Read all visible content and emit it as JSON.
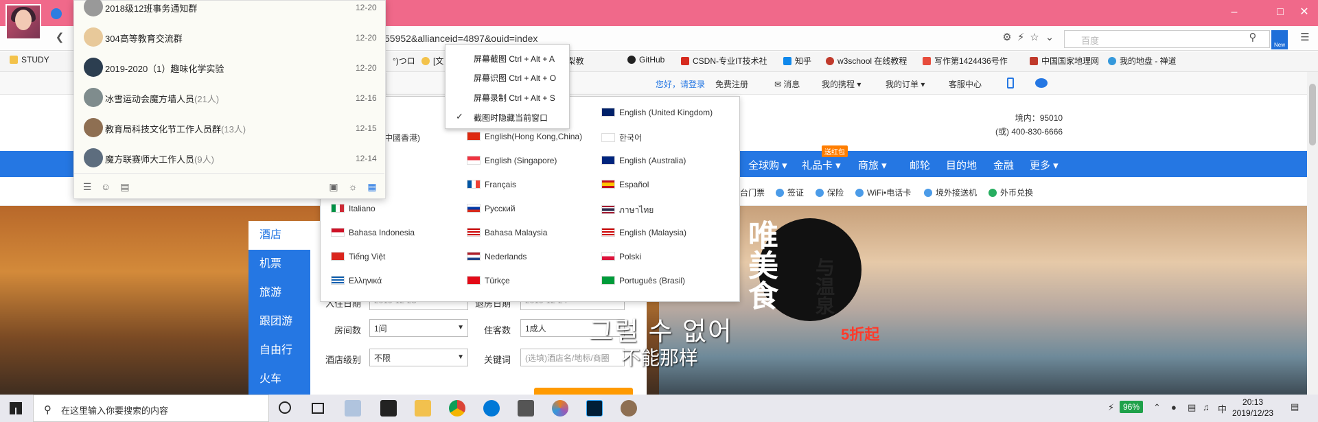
{
  "browser": {
    "url": "55952&allianceid=4897&ouid=index",
    "search_placeholder": "百度",
    "new_badge": "New",
    "colors": {
      "titlebar": "#f0698a",
      "nav_blue": "#2577e3",
      "accent_orange": "#ff9a00"
    }
  },
  "bookmarks": [
    {
      "label": "STUDY"
    },
    {
      "label": "°)つロ"
    },
    {
      "label": "[文"
    },
    {
      "label": "主题 - 雪梨教"
    },
    {
      "label": "GitHub"
    },
    {
      "label": "CSDN-专业IT技术社"
    },
    {
      "label": "知乎"
    },
    {
      "label": "w3school 在线教程"
    },
    {
      "label": "写作第1424436号作"
    },
    {
      "label": "中国国家地理网"
    },
    {
      "label": "我的地盘 - 禅道"
    }
  ],
  "site_top": {
    "greeting": "您好，请登录",
    "register": "免费注册",
    "messages": "消息",
    "my_trip": "我的携程",
    "my_orders": "我的订单",
    "service": "客服中心"
  },
  "hotline": {
    "line1": "境内：95010",
    "line2": "(或) 400-830-6666"
  },
  "main_nav": [
    {
      "label": "全球购"
    },
    {
      "label": "礼品卡"
    },
    {
      "label": "商旅"
    },
    {
      "label": "邮轮"
    },
    {
      "label": "目的地"
    },
    {
      "label": "金融"
    },
    {
      "label": "更多"
    }
  ],
  "gift_badge": "送红包",
  "sub_nav": [
    {
      "label": "台门票"
    },
    {
      "label": "签证"
    },
    {
      "label": "保险"
    },
    {
      "label": "WiFi•电话卡"
    },
    {
      "label": "境外接送机"
    },
    {
      "label": "外币兑换"
    }
  ],
  "booking": {
    "tabs": [
      {
        "label": "酒店"
      },
      {
        "label": "机票"
      },
      {
        "label": "旅游"
      },
      {
        "label": "跟团游"
      },
      {
        "label": "自由行"
      },
      {
        "label": "火车"
      }
    ],
    "checkin_label": "入住日期",
    "checkin_value": "2019-12-23",
    "checkout_label": "退房日期",
    "checkout_value": "2019-12-24",
    "rooms_label": "房间数",
    "rooms_value": "1间",
    "guests_label": "住客数",
    "guests_value": "1成人",
    "level_label": "酒店级别",
    "level_value": "不限",
    "keyword_label": "关键词",
    "keyword_placeholder": "(选填)酒店名/地标/商圈"
  },
  "banner": {
    "promo_line1": "唯美食",
    "promo_line2": "与温泉",
    "promo_discount": "5折起",
    "overlay_ko": "그럴 수 없어",
    "overlay_zh": "不能那样"
  },
  "languages": [
    {
      "label": "(中國香港)",
      "flag": "hk"
    },
    {
      "label": "English(Hong Kong,China)",
      "flag": "hk"
    },
    {
      "label": "English (United Kingdom)",
      "flag": "uk"
    },
    {
      "label": "English (Singapore)",
      "flag": "sg"
    },
    {
      "label": "한국어",
      "flag": "kr"
    },
    {
      "label": "English (Australia)",
      "flag": "au"
    },
    {
      "label": "Français",
      "flag": "fr"
    },
    {
      "label": "Español",
      "flag": "es"
    },
    {
      "label": "Italiano",
      "flag": "it"
    },
    {
      "label": "Русский",
      "flag": "ru"
    },
    {
      "label": "ภาษาไทย",
      "flag": "th"
    },
    {
      "label": "Bahasa Indonesia",
      "flag": "id"
    },
    {
      "label": "Bahasa Malaysia",
      "flag": "my"
    },
    {
      "label": "English (Malaysia)",
      "flag": "my"
    },
    {
      "label": "Tiếng Việt",
      "flag": "vn"
    },
    {
      "label": "Nederlands",
      "flag": "nl"
    },
    {
      "label": "Polski",
      "flag": "pl"
    },
    {
      "label": "Ελληνικά",
      "flag": "gr"
    },
    {
      "label": "Türkçe",
      "flag": "tr"
    },
    {
      "label": "Português (Brasil)",
      "flag": "br"
    }
  ],
  "context_menu": {
    "items": [
      {
        "label": "屏幕截图 Ctrl + Alt + A"
      },
      {
        "label": "屏幕识图 Ctrl + Alt + O"
      },
      {
        "label": "屏幕录制 Ctrl + Alt + S"
      },
      {
        "label": "截图时隐藏当前窗口"
      }
    ],
    "check_mark": "✓"
  },
  "chat": {
    "groups": [
      {
        "name": "2018级12班事务通知群",
        "count": "",
        "date": "12-20"
      },
      {
        "name": "304高等教育交流群",
        "count": "",
        "date": "12-20"
      },
      {
        "name": "2019-2020（1）趣味化学实验",
        "count": "",
        "date": "12-20"
      },
      {
        "name": "冰雪运动会魔方墙人员",
        "count": "(21人)",
        "date": "12-16"
      },
      {
        "name": "教育局科技文化节工作人员群",
        "count": "(13人)",
        "date": "12-15"
      },
      {
        "name": "魔方联赛师大工作人员",
        "count": "(9人)",
        "date": "12-14"
      }
    ]
  },
  "taskbar": {
    "search_placeholder": "在这里输入你要搜索的内容",
    "battery": "96%",
    "ime": "中",
    "time": "20:13",
    "date": "2019/12/23"
  }
}
